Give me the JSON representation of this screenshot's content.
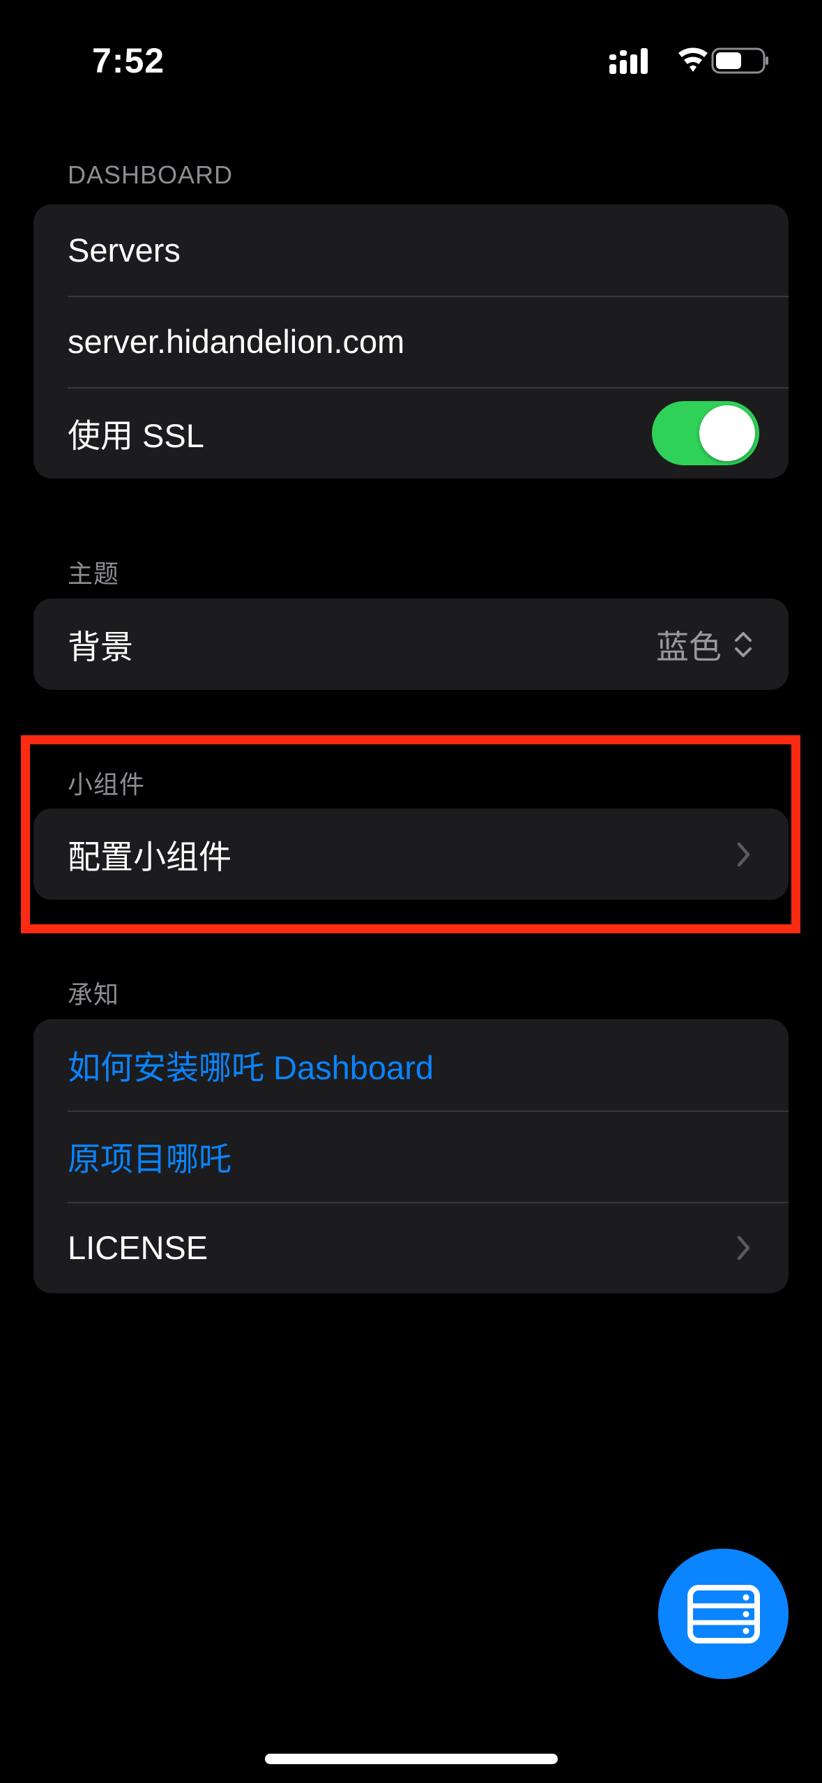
{
  "status_bar": {
    "time": "7:52",
    "icons": [
      "cellular-signal-icon",
      "wifi-icon",
      "battery-icon"
    ]
  },
  "sections": {
    "dashboard": {
      "header": "DASHBOARD",
      "servers_label": "Servers",
      "server_address": "server.hidandelion.com",
      "ssl_label": "使用 SSL",
      "ssl_enabled": true
    },
    "theme": {
      "header": "主题",
      "background_label": "背景",
      "background_value": "蓝色"
    },
    "widgets": {
      "header": "小组件",
      "configure_label": "配置小组件"
    },
    "acknowledgements": {
      "header": "承知",
      "install_link": "如何安装哪吒 Dashboard",
      "original_project_link": "原项目哪吒",
      "license_label": "LICENSE"
    }
  },
  "fab": {
    "icon": "server-stack-icon"
  },
  "colors": {
    "accent": "#0a84ff",
    "toggle_on": "#30d158",
    "highlight": "#ff2a12",
    "group_background": "#1c1c1e"
  }
}
